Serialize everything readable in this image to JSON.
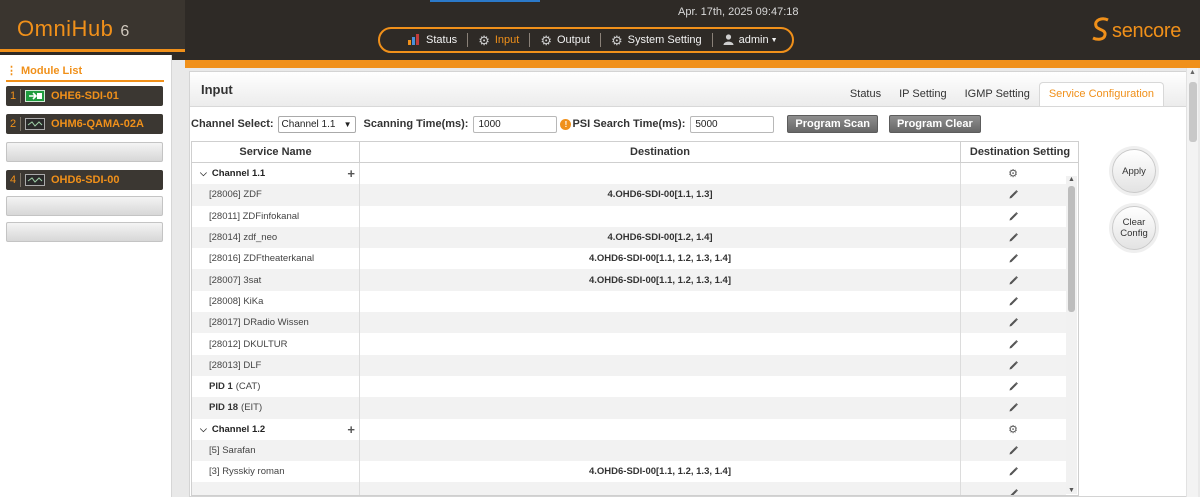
{
  "header": {
    "app_name": "OmniHub",
    "app_version": "6",
    "datetime": "Apr. 17th, 2025 09:47:18",
    "brand": "sencore",
    "nav": [
      {
        "label": "Status",
        "icon": "bar-chart-icon",
        "active": false
      },
      {
        "label": "Input",
        "icon": "gear-icon",
        "active": true
      },
      {
        "label": "Output",
        "icon": "gear-icon",
        "active": false
      },
      {
        "label": "System Setting",
        "icon": "gear-icon",
        "active": false
      },
      {
        "label": "admin",
        "icon": "user-icon",
        "active": false
      }
    ]
  },
  "sidebar": {
    "title": "Module List",
    "modules": [
      {
        "num": "1",
        "name": "OHE6-SDI-01",
        "icon": "input-module-icon"
      },
      {
        "num": "2",
        "name": "OHM6-QAMA-02A",
        "icon": "module-icon"
      },
      {
        "num": "4",
        "name": "OHD6-SDI-00",
        "icon": "module-icon"
      }
    ]
  },
  "main": {
    "title": "Input",
    "tabs": [
      {
        "label": "Status",
        "active": false
      },
      {
        "label": "IP Setting",
        "active": false
      },
      {
        "label": "IGMP Setting",
        "active": false
      },
      {
        "label": "Service Configuration",
        "active": true
      }
    ],
    "controls": {
      "channel_label": "Channel Select:",
      "channel_value": "Channel 1.1",
      "scan_label": "Scanning Time(ms):",
      "scan_value": "1000",
      "psi_label": "PSI Search Time(ms):",
      "psi_value": "5000",
      "program_scan": "Program Scan",
      "program_clear": "Program Clear"
    },
    "table": {
      "headers": [
        "Service Name",
        "Destination",
        "Destination Setting"
      ],
      "rows": [
        {
          "type": "group",
          "name": "Channel 1.1",
          "destination": "",
          "setting": "gear-icon"
        },
        {
          "type": "service",
          "name": "[28006] ZDF",
          "destination": "4.OHD6-SDI-00[1.1, 1.3]",
          "setting": "pencil-icon"
        },
        {
          "type": "service",
          "name": "[28011] ZDFinfokanal",
          "destination": "",
          "setting": "pencil-icon"
        },
        {
          "type": "service",
          "name": "[28014] zdf_neo",
          "destination": "4.OHD6-SDI-00[1.2, 1.4]",
          "setting": "pencil-icon"
        },
        {
          "type": "service",
          "name": "[28016] ZDFtheaterkanal",
          "destination": "4.OHD6-SDI-00[1.1, 1.2, 1.3, 1.4]",
          "setting": "pencil-icon"
        },
        {
          "type": "service",
          "name": "[28007] 3sat",
          "destination": "4.OHD6-SDI-00[1.1, 1.2, 1.3, 1.4]",
          "setting": "pencil-icon"
        },
        {
          "type": "service",
          "name": "[28008] KiKa",
          "destination": "",
          "setting": "pencil-icon"
        },
        {
          "type": "service",
          "name": "[28017] DRadio Wissen",
          "destination": "",
          "setting": "pencil-icon"
        },
        {
          "type": "service",
          "name": "[28012] DKULTUR",
          "destination": "",
          "setting": "pencil-icon"
        },
        {
          "type": "service",
          "name": "[28013] DLF",
          "destination": "",
          "setting": "pencil-icon"
        },
        {
          "type": "pid",
          "pid": "PID 1",
          "name": "(CAT)",
          "destination": "",
          "setting": "pencil-icon"
        },
        {
          "type": "pid",
          "pid": "PID 18",
          "name": "(EIT)",
          "destination": "",
          "setting": "pencil-icon"
        },
        {
          "type": "group",
          "name": "Channel 1.2",
          "destination": "",
          "setting": "gear-icon"
        },
        {
          "type": "service",
          "name": "[5] Sarafan",
          "destination": "",
          "setting": "pencil-icon"
        },
        {
          "type": "service",
          "name": "[3] Rysskiy roman",
          "destination": "4.OHD6-SDI-00[1.1, 1.2, 1.3, 1.4]",
          "setting": "pencil-icon"
        },
        {
          "type": "service",
          "name": "",
          "destination": "",
          "setting": "pencil-icon"
        }
      ]
    },
    "apply_label": "Apply",
    "clear_config_label_1": "Clear",
    "clear_config_label_2": "Config"
  },
  "colors": {
    "accent": "#f0901a",
    "header_bg": "#2e2a26",
    "button_gray": "#767676"
  }
}
